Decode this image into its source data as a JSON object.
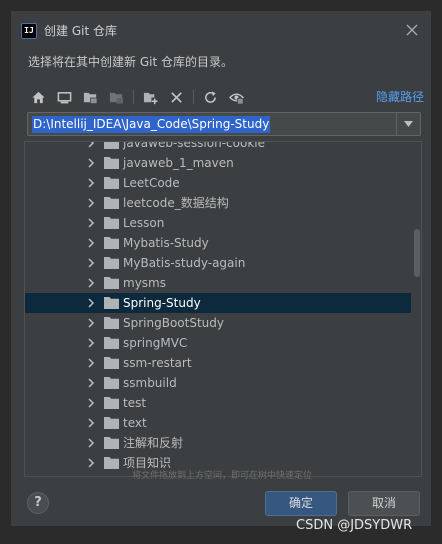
{
  "dialog": {
    "app_icon_text": "IJ",
    "title": "创建 Git 仓库",
    "description": "选择将在其中创建新 Git 仓库的目录。"
  },
  "toolbar": {
    "buttons": [
      {
        "icon": "home-icon",
        "enabled": true
      },
      {
        "icon": "desktop-icon",
        "enabled": true
      },
      {
        "icon": "project-folder-icon",
        "enabled": true
      },
      {
        "icon": "module-folder-icon",
        "enabled": false
      },
      {
        "icon": "new-folder-icon",
        "enabled": true
      },
      {
        "icon": "delete-icon",
        "enabled": true
      },
      {
        "icon": "refresh-icon",
        "enabled": true
      },
      {
        "icon": "show-hidden-icon",
        "enabled": true
      }
    ],
    "hide_path_label": "隐藏路径"
  },
  "path": {
    "value": "D:\\Intellij_IDEA\\Java_Code\\Spring-Study"
  },
  "tree": {
    "items": [
      {
        "label": "javaweb-session-cookie",
        "selected": false
      },
      {
        "label": "javaweb_1_maven",
        "selected": false
      },
      {
        "label": "LeetCode",
        "selected": false
      },
      {
        "label": "leetcode_数据结构",
        "selected": false
      },
      {
        "label": "Lesson",
        "selected": false
      },
      {
        "label": "Mybatis-Study",
        "selected": false
      },
      {
        "label": "MyBatis-study-again",
        "selected": false
      },
      {
        "label": "mysms",
        "selected": false
      },
      {
        "label": "Spring-Study",
        "selected": true
      },
      {
        "label": "SpringBootStudy",
        "selected": false
      },
      {
        "label": "springMVC",
        "selected": false
      },
      {
        "label": "ssm-restart",
        "selected": false
      },
      {
        "label": "ssmbuild",
        "selected": false
      },
      {
        "label": "test",
        "selected": false
      },
      {
        "label": "text",
        "selected": false
      },
      {
        "label": "注解和反射",
        "selected": false
      },
      {
        "label": "项目知识",
        "selected": false
      }
    ]
  },
  "hint": "将文件拖放到上方空间，即可在树中快速定位",
  "footer": {
    "help_label": "?",
    "ok_label": "确定",
    "cancel_label": "取消"
  },
  "watermark": "CSDN @JDSYDWR",
  "colors": {
    "dialog_bg": "#3c3f41",
    "selection_bg": "#0d293e",
    "link": "#589df6",
    "primary_button": "#365880",
    "path_highlight": "#2f65ca"
  }
}
